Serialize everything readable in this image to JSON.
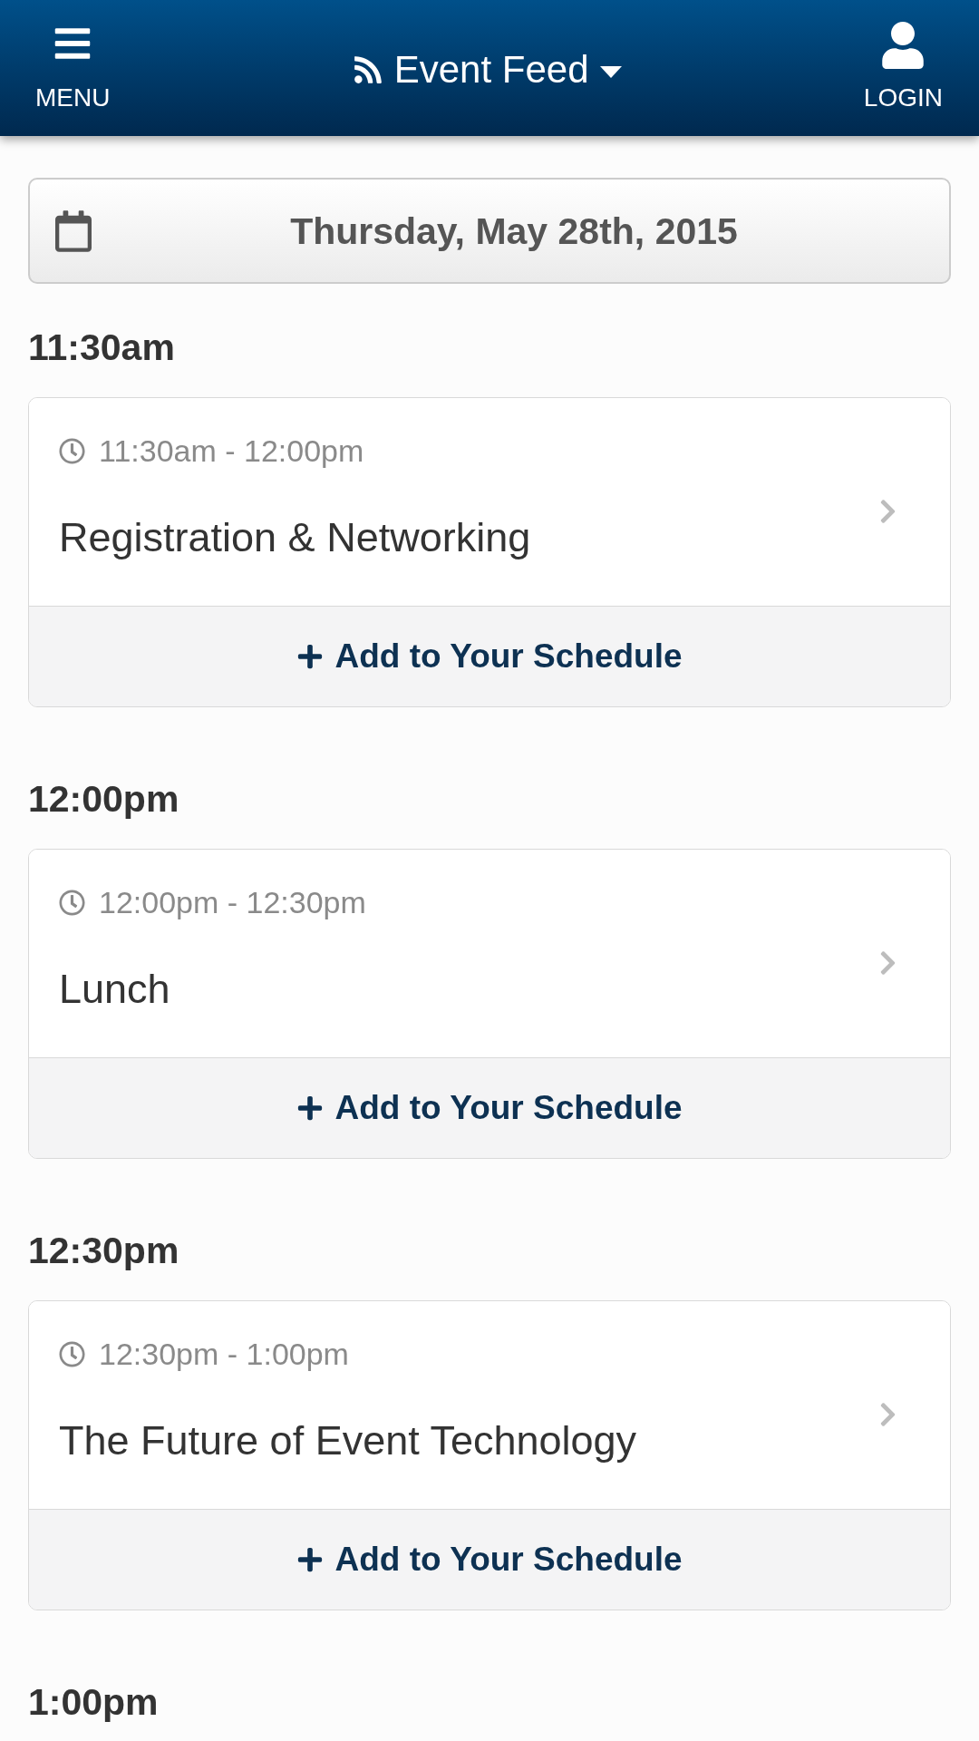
{
  "header": {
    "menu_label": "MENU",
    "feed_title": "Event Feed",
    "login_label": "LOGIN"
  },
  "date_button": {
    "label": "Thursday, May 28th, 2015"
  },
  "time_slots": [
    {
      "heading": "11:30am",
      "events": [
        {
          "time_range": "11:30am - 12:00pm",
          "title": "Registration & Networking",
          "action": "Add to Your Schedule"
        }
      ]
    },
    {
      "heading": "12:00pm",
      "events": [
        {
          "time_range": "12:00pm - 12:30pm",
          "title": "Lunch",
          "action": "Add to Your Schedule"
        }
      ]
    },
    {
      "heading": "12:30pm",
      "events": [
        {
          "time_range": "12:30pm - 1:00pm",
          "title": "The Future of Event Technology",
          "action": "Add to Your Schedule"
        }
      ]
    },
    {
      "heading": "1:00pm"
    }
  ]
}
